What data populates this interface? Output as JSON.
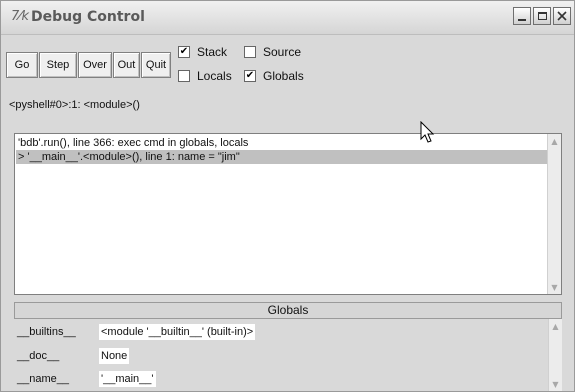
{
  "window": {
    "title": "Debug Control",
    "icon_glyph": "7⁄k"
  },
  "toolbar": {
    "buttons": {
      "go": "Go",
      "step": "Step",
      "over": "Over",
      "out": "Out",
      "quit": "Quit"
    },
    "checkboxes": {
      "stack": {
        "label": "Stack",
        "checked": true
      },
      "source": {
        "label": "Source",
        "checked": false
      },
      "locals": {
        "label": "Locals",
        "checked": false
      },
      "globals": {
        "label": "Globals",
        "checked": true
      }
    },
    "status": "<pyshell#0>:1: <module>()"
  },
  "stack": {
    "frames": [
      {
        "text": "'bdb'.run(), line 366: exec cmd in globals, locals",
        "selected": false
      },
      {
        "text": "> '__main__'.<module>(), line 1: name = \"jim\"",
        "selected": true
      }
    ]
  },
  "globals": {
    "header": "Globals",
    "rows": [
      {
        "name": "__builtins__",
        "value": "<module '__builtin__' (built-in)>"
      },
      {
        "name": "__doc__",
        "value": "None"
      },
      {
        "name": "__name__",
        "value": "'__main__'"
      }
    ]
  },
  "icons": [
    "minimize-icon",
    "maximize-icon",
    "close-icon",
    "scroll-up-arrow-icon",
    "scroll-down-arrow-icon",
    "mouse-cursor-icon"
  ]
}
